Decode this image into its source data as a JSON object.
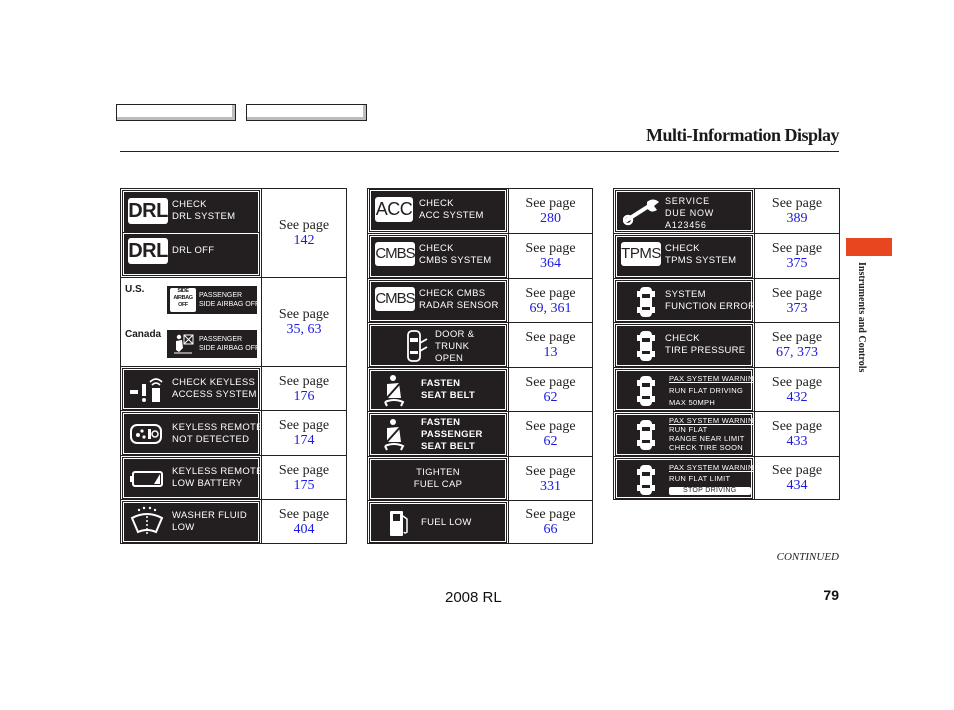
{
  "nav": {
    "buttons": [
      "",
      ""
    ]
  },
  "header": {
    "title": "Multi-Information Display"
  },
  "see_page_label": "See page",
  "tables": [
    {
      "rows": [
        {
          "displays": [
            {
              "icon": "drl-badge",
              "badge": "DRL",
              "lines": [
                "CHECK",
                "DRL SYSTEM"
              ]
            },
            {
              "icon": "drl-badge",
              "badge": "DRL",
              "lines": [
                "DRL OFF"
              ]
            }
          ],
          "pages": "142"
        },
        {
          "variants": [
            {
              "region": "U.S.",
              "icon": "side-airbag-off-badge",
              "badge_lines": [
                "SIDE",
                "AIRBAG",
                "OFF"
              ],
              "lines": [
                "PASSENGER",
                "SIDE AIRBAG OFF"
              ]
            },
            {
              "region": "Canada",
              "icon": "airbag-off-icon",
              "lines": [
                "PASSENGER",
                "SIDE AIRBAG OFF"
              ]
            }
          ],
          "pages": "35, 63"
        },
        {
          "displays": [
            {
              "icon": "keyless-access-icon",
              "lines": [
                "CHECK KEYLESS",
                "ACCESS SYSTEM"
              ]
            }
          ],
          "pages": "176"
        },
        {
          "displays": [
            {
              "icon": "keyless-remote-icon",
              "lines": [
                "KEYLESS REMOTE",
                "NOT DETECTED"
              ]
            }
          ],
          "pages": "174"
        },
        {
          "displays": [
            {
              "icon": "low-battery-icon",
              "lines": [
                "KEYLESS REMOTE",
                "LOW BATTERY"
              ]
            }
          ],
          "pages": "175"
        },
        {
          "displays": [
            {
              "icon": "washer-fluid-icon",
              "lines": [
                "WASHER FLUID",
                "LOW"
              ]
            }
          ],
          "pages": "404"
        }
      ]
    },
    {
      "rows": [
        {
          "displays": [
            {
              "icon": "acc-badge",
              "badge": "ACC",
              "lines": [
                "CHECK",
                "ACC SYSTEM"
              ]
            }
          ],
          "pages": "280"
        },
        {
          "displays": [
            {
              "icon": "cmbs-badge",
              "badge": "CMBS",
              "lines": [
                "CHECK",
                "CMBS SYSTEM"
              ]
            }
          ],
          "pages": "364"
        },
        {
          "displays": [
            {
              "icon": "cmbs-badge",
              "badge": "CMBS",
              "lines": [
                "CHECK  CMBS",
                "RADAR  SENSOR"
              ]
            }
          ],
          "pages": "69, 361"
        },
        {
          "displays": [
            {
              "icon": "door-trunk-open-icon",
              "lines": [
                "DOOR &",
                "TRUNK",
                "OPEN"
              ]
            }
          ],
          "pages": "13"
        },
        {
          "displays": [
            {
              "icon": "seat-belt-icon",
              "lines": [
                "FASTEN",
                "SEAT BELT"
              ]
            }
          ],
          "pages": "62"
        },
        {
          "displays": [
            {
              "icon": "seat-belt-icon",
              "lines": [
                "FASTEN",
                "PASSENGER",
                "SEAT BELT"
              ]
            }
          ],
          "pages": "62"
        },
        {
          "displays": [
            {
              "icon": "none",
              "lines": [
                "TIGHTEN",
                "FUEL CAP"
              ]
            }
          ],
          "pages": "331"
        },
        {
          "displays": [
            {
              "icon": "fuel-pump-icon",
              "lines": [
                "FUEL LOW"
              ]
            }
          ],
          "pages": "66"
        }
      ]
    },
    {
      "rows": [
        {
          "displays": [
            {
              "icon": "wrench-icon",
              "lines": [
                "SERVICE",
                "DUE NOW",
                "A123456"
              ]
            }
          ],
          "pages": "389"
        },
        {
          "displays": [
            {
              "icon": "tpms-badge",
              "badge": "TPMS",
              "lines": [
                "CHECK",
                "TPMS SYSTEM"
              ]
            }
          ],
          "pages": "375"
        },
        {
          "displays": [
            {
              "icon": "car-top-view-icon",
              "lines": [
                "SYSTEM",
                "FUNCTION ERROR"
              ]
            }
          ],
          "pages": "373"
        },
        {
          "displays": [
            {
              "icon": "car-top-view-icon",
              "lines": [
                "CHECK",
                "TIRE PRESSURE"
              ]
            }
          ],
          "pages": "67, 373"
        },
        {
          "displays": [
            {
              "icon": "car-top-view-icon",
              "header": "PAX SYSTEM WARNING",
              "lines": [
                "RUN FLAT DRIVING",
                "MAX 50MPH"
              ]
            }
          ],
          "pages": "432"
        },
        {
          "displays": [
            {
              "icon": "car-top-view-icon",
              "header": "PAX SYSTEM WARNING",
              "lines": [
                "RUN FLAT",
                "RANGE NEAR LIMIT",
                "CHECK TIRE SOON"
              ]
            }
          ],
          "pages": "433"
        },
        {
          "displays": [
            {
              "icon": "car-top-view-icon",
              "header": "PAX SYSTEM WARNING",
              "lines": [
                "RUN FLAT LIMIT"
              ],
              "boxed": "STOP DRIVING"
            }
          ],
          "pages": "434"
        }
      ]
    }
  ],
  "side_tab": {
    "label": "Instruments and Controls",
    "color": "#e8461e"
  },
  "footer": {
    "continued": "CONTINUED",
    "model": "2008  RL",
    "page_number": "79"
  },
  "colors": {
    "link": "#1a1ae0",
    "display_bg": "#231f20"
  }
}
